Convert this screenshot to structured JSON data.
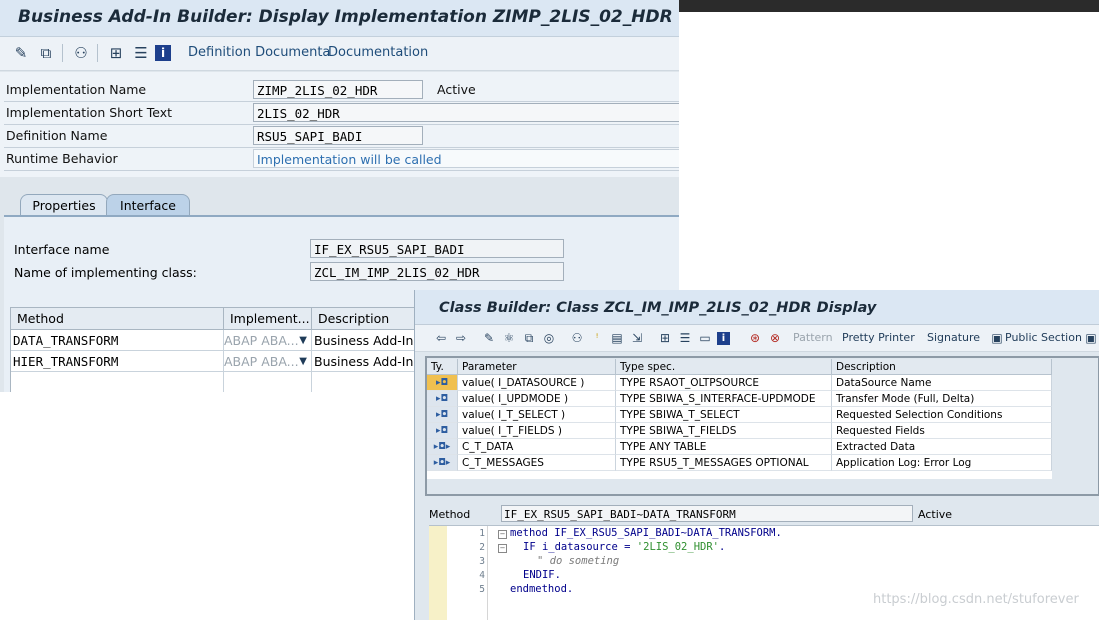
{
  "badi": {
    "title": "Business Add-In Builder: Display Implementation ZIMP_2LIS_02_HDR",
    "toolbar": {
      "definition_doc": "Definition Documenta",
      "documentation": "Documentation"
    },
    "form": {
      "impl_name_label": "Implementation Name",
      "impl_name_value": "ZIMP_2LIS_02_HDR",
      "impl_status": "Active",
      "short_text_label": "Implementation Short Text",
      "short_text_value": "2LIS_02_HDR",
      "def_name_label": "Definition Name",
      "def_name_value": "RSU5_SAPI_BADI",
      "runtime_label": "Runtime Behavior",
      "runtime_value": "Implementation will be called"
    },
    "tabs": [
      "Properties",
      "Interface"
    ],
    "interface": {
      "iname_label": "Interface name",
      "iname_value": "IF_EX_RSU5_SAPI_BADI",
      "class_label": "Name of implementing class:",
      "class_value": "ZCL_IM_IMP_2LIS_02_HDR"
    },
    "methods": {
      "headers": [
        "Method",
        "Implement...",
        "Description"
      ],
      "rows": [
        {
          "method": "DATA_TRANSFORM",
          "impl": "ABAP ABA...",
          "desc": "Business Add-Ins M"
        },
        {
          "method": "HIER_TRANSFORM",
          "impl": "ABAP ABA...",
          "desc": "Business Add-Ins M"
        }
      ]
    }
  },
  "class_builder": {
    "title": "Class Builder: Class ZCL_IM_IMP_2LIS_02_HDR Display",
    "toolbar": {
      "pattern": "Pattern",
      "pretty_printer": "Pretty Printer",
      "signature": "Signature",
      "public_section": "Public Section"
    },
    "params": {
      "headers": [
        "Ty.",
        "Parameter",
        "Type spec.",
        "Description"
      ],
      "rows": [
        {
          "ty": "▸◘",
          "param": "value( I_DATASOURCE )",
          "type": "TYPE RSAOT_OLTPSOURCE",
          "desc": "DataSource Name"
        },
        {
          "ty": "▸◘",
          "param": "value( I_UPDMODE )",
          "type": "TYPE SBIWA_S_INTERFACE-UPDMODE",
          "desc": "Transfer Mode (Full, Delta)"
        },
        {
          "ty": "▸◘",
          "param": "value( I_T_SELECT )",
          "type": "TYPE SBIWA_T_SELECT",
          "desc": "Requested Selection Conditions"
        },
        {
          "ty": "▸◘",
          "param": "value( I_T_FIELDS )",
          "type": "TYPE SBIWA_T_FIELDS",
          "desc": "Requested Fields"
        },
        {
          "ty": "▸◘▸",
          "param": "C_T_DATA",
          "type": "TYPE ANY TABLE",
          "desc": "Extracted Data"
        },
        {
          "ty": "▸◘▸",
          "param": "C_T_MESSAGES",
          "type": "TYPE RSU5_T_MESSAGES OPTIONAL",
          "desc": "Application Log: Error Log"
        }
      ]
    },
    "method_label": "Method",
    "method_value": "IF_EX_RSU5_SAPI_BADI~DATA_TRANSFORM",
    "method_status": "Active",
    "code": {
      "line_numbers": [
        "1",
        "2",
        "3",
        "4",
        "5"
      ],
      "l1": "method IF_EX_RSU5_SAPI_BADI~DATA_TRANSFORM.",
      "l2a": "IF i_datasource = ",
      "l2b": "'2LIS_02_HDR'",
      "l2c": ".",
      "l3": "\" do someting",
      "l4": "ENDIF.",
      "l5": "endmethod."
    }
  },
  "watermark": "https://blog.csdn.net/stuforever"
}
